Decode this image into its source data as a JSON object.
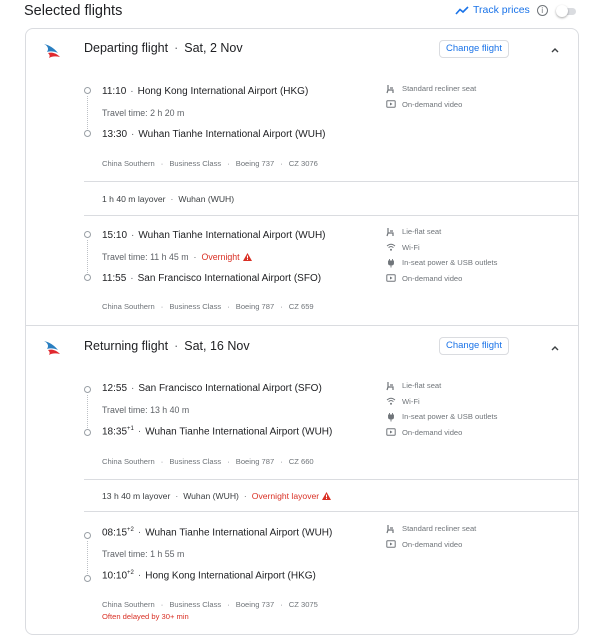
{
  "header": {
    "title": "Selected flights",
    "track_label": "Track prices",
    "info_glyph": "i"
  },
  "colors": {
    "accent": "#1a73e8",
    "warning": "#d93025",
    "border": "#dadce0",
    "muted_text": "#70757a"
  },
  "departing": {
    "title": "Departing flight",
    "date": "Sat, 2 Nov",
    "change_label": "Change flight",
    "segments": [
      {
        "depart_time": "11:10",
        "depart_airport": "Hong Kong International Airport (HKG)",
        "travel_time": "Travel time: 2 h 20 m",
        "arrive_time": "13:30",
        "arrive_airport": "Wuhan Tianhe International Airport (WUH)",
        "airline": "China Southern",
        "cabin": "Business Class",
        "aircraft": "Boeing 737",
        "flight_no": "CZ 3076",
        "amenities": [
          {
            "icon": "seat-icon",
            "label": "Standard recliner seat"
          },
          {
            "icon": "video-icon",
            "label": "On-demand video"
          }
        ]
      },
      {
        "depart_time": "15:10",
        "depart_airport": "Wuhan Tianhe International Airport (WUH)",
        "travel_time": "Travel time: 11 h 45 m",
        "overnight": "Overnight",
        "arrive_time": "11:55",
        "arrive_airport": "San Francisco International Airport (SFO)",
        "airline": "China Southern",
        "cabin": "Business Class",
        "aircraft": "Boeing 787",
        "flight_no": "CZ 659",
        "amenities": [
          {
            "icon": "seat-icon",
            "label": "Lie-flat seat"
          },
          {
            "icon": "wifi-icon",
            "label": "Wi-Fi"
          },
          {
            "icon": "power-icon",
            "label": "In-seat power & USB outlets"
          },
          {
            "icon": "video-icon",
            "label": "On-demand video"
          }
        ]
      }
    ],
    "layover": {
      "duration": "1 h 40 m layover",
      "city": "Wuhan (WUH)"
    }
  },
  "returning": {
    "title": "Returning flight",
    "date": "Sat, 16 Nov",
    "change_label": "Change flight",
    "segments": [
      {
        "depart_time": "12:55",
        "depart_airport": "San Francisco International Airport (SFO)",
        "travel_time": "Travel time: 13 h 40 m",
        "arrive_time": "18:35",
        "arrive_offset": "+1",
        "arrive_airport": "Wuhan Tianhe International Airport (WUH)",
        "airline": "China Southern",
        "cabin": "Business Class",
        "aircraft": "Boeing 787",
        "flight_no": "CZ 660",
        "amenities": [
          {
            "icon": "seat-icon",
            "label": "Lie-flat seat"
          },
          {
            "icon": "wifi-icon",
            "label": "Wi-Fi"
          },
          {
            "icon": "power-icon",
            "label": "In-seat power & USB outlets"
          },
          {
            "icon": "video-icon",
            "label": "On-demand video"
          }
        ]
      },
      {
        "depart_time": "08:15",
        "depart_offset": "+2",
        "depart_airport": "Wuhan Tianhe International Airport (WUH)",
        "travel_time": "Travel time: 1 h 55 m",
        "arrive_time": "10:10",
        "arrive_offset": "+2",
        "arrive_airport": "Hong Kong International Airport (HKG)",
        "airline": "China Southern",
        "cabin": "Business Class",
        "aircraft": "Boeing 737",
        "flight_no": "CZ 3075",
        "delay_note": "Often delayed by 30+ min",
        "amenities": [
          {
            "icon": "seat-icon",
            "label": "Standard recliner seat"
          },
          {
            "icon": "video-icon",
            "label": "On-demand video"
          }
        ]
      }
    ],
    "layover": {
      "duration": "13 h 40 m layover",
      "city": "Wuhan (WUH)",
      "overnight": "Overnight layover"
    }
  }
}
